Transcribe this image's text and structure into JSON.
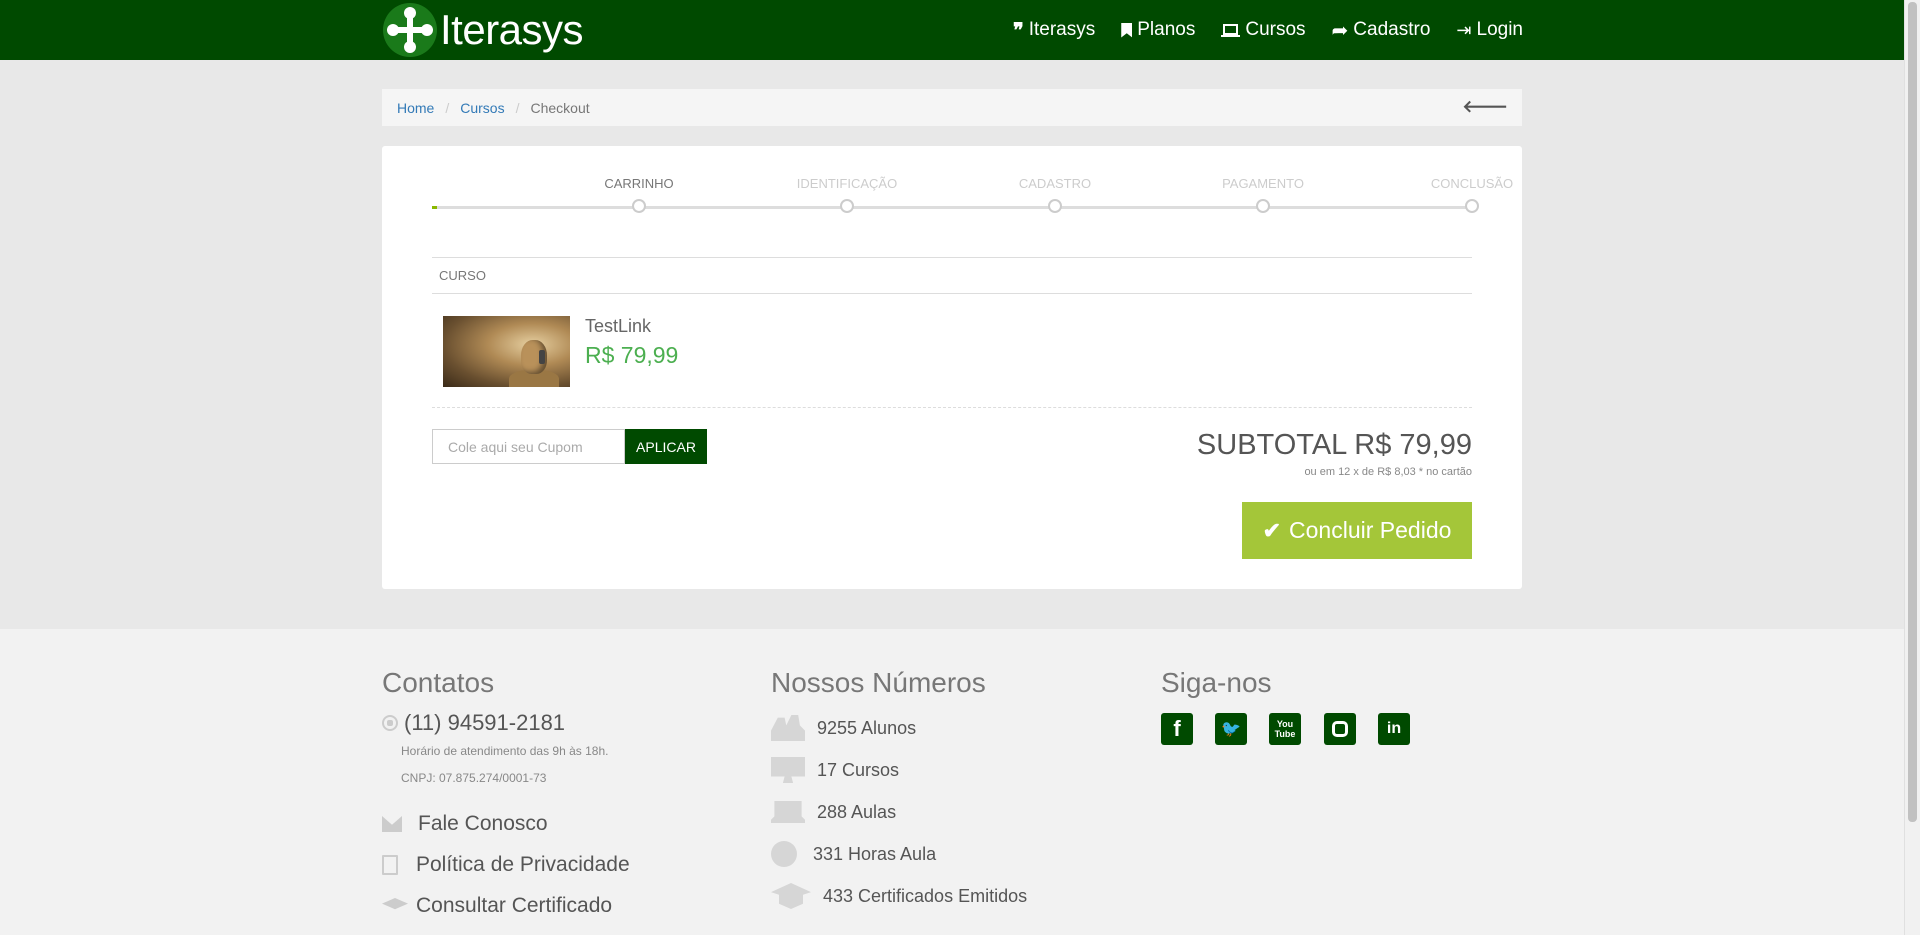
{
  "nav": {
    "brand": "Iterasys",
    "items": [
      {
        "label": "Iterasys",
        "icon": "quote-icon"
      },
      {
        "label": "Planos",
        "icon": "bookmark-icon"
      },
      {
        "label": "Cursos",
        "icon": "laptop-icon"
      },
      {
        "label": "Cadastro",
        "icon": "share-icon"
      },
      {
        "label": "Login",
        "icon": "sign-in-icon"
      }
    ]
  },
  "breadcrumb": {
    "items": [
      "Home",
      "Cursos"
    ],
    "active": "Checkout"
  },
  "steps": [
    "CARRINHO",
    "IDENTIFICAÇÃO",
    "CADASTRO",
    "PAGAMENTO",
    "CONCLUSÃO"
  ],
  "cart": {
    "column_header": "CURSO",
    "item": {
      "name": "TestLink",
      "price": "R$ 79,99"
    },
    "coupon_placeholder": "Cole aqui seu Cupom",
    "apply_label": "APLICAR",
    "subtotal": "SUBTOTAL R$ 79,99",
    "installments": "ou em 12 x de R$ 8,03 * no cartão",
    "conclude_label": "Concluir Pedido"
  },
  "footer": {
    "contacts": {
      "title": "Contatos",
      "phone": "(11) 94591-2181",
      "hours": "Horário de atendimento das 9h às 18h.",
      "cnpj": "CNPJ: 07.875.274/0001-73",
      "links": [
        "Fale Conosco",
        "Política de Privacidade",
        "Consultar Certificado"
      ]
    },
    "numbers": {
      "title": "Nossos Números",
      "items": [
        "9255 Alunos",
        "17 Cursos",
        "288 Aulas",
        "331 Horas Aula",
        "433 Certificados Emitidos"
      ]
    },
    "social": {
      "title": "Siga-nos",
      "networks": [
        "facebook",
        "twitter",
        "youtube",
        "instagram",
        "linkedin"
      ],
      "youtube_logo_text": "You Tube"
    }
  },
  "colors": {
    "nav_bg": "#004a00",
    "accent_green": "#a4c639",
    "price_green": "#4caf50",
    "link_blue": "#337ab7"
  }
}
